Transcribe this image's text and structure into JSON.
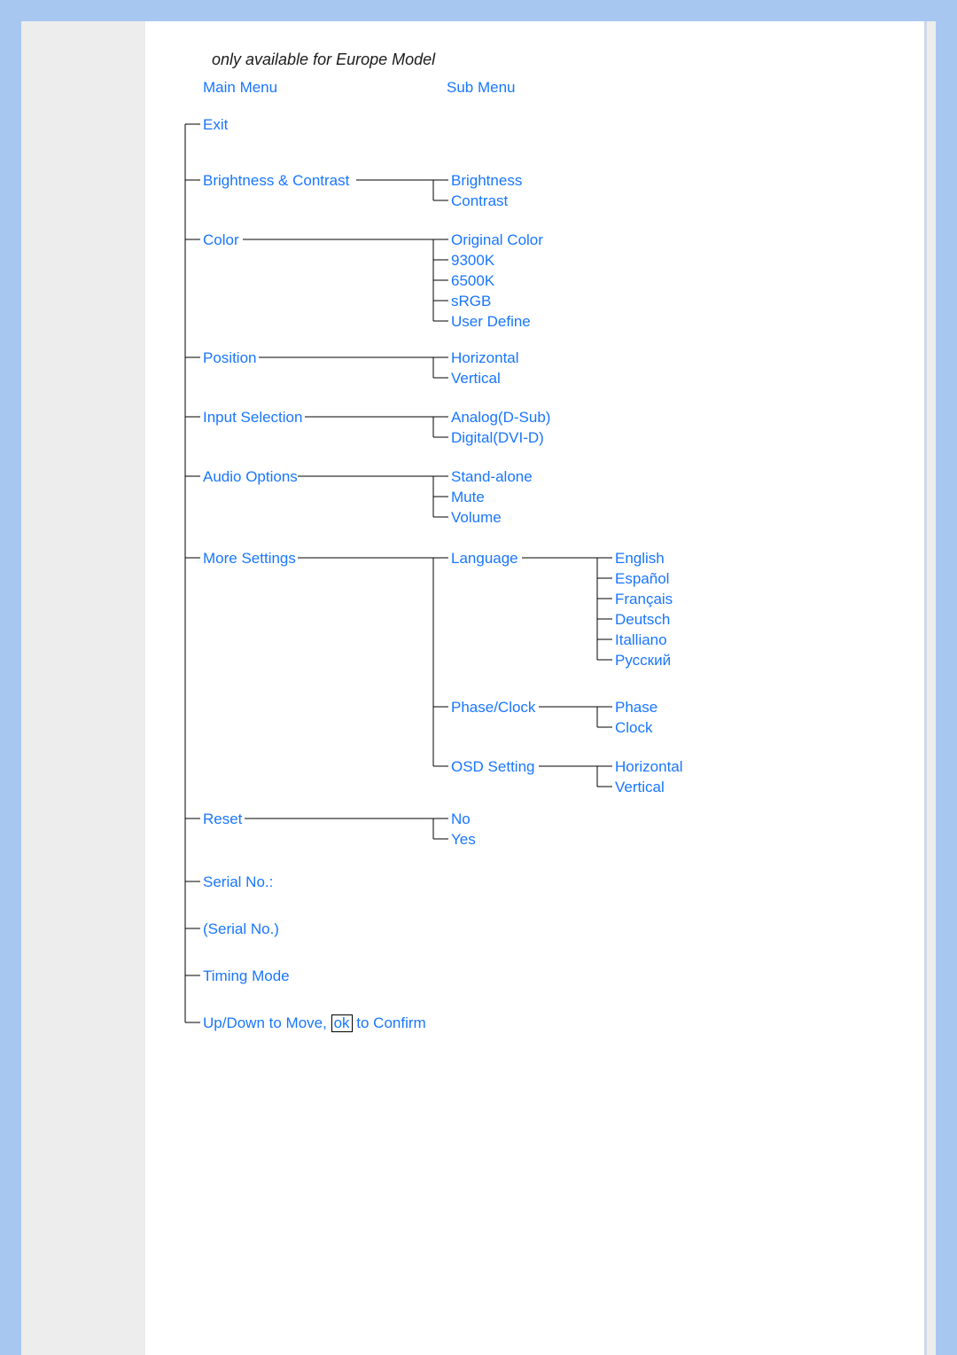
{
  "note": "only available for Europe Model",
  "headers": {
    "main": "Main Menu",
    "sub": "Sub Menu"
  },
  "main": {
    "exit": "Exit",
    "brightness_contrast": "Brightness & Contrast",
    "color": "Color",
    "position": "Position",
    "input_selection": "Input Selection",
    "audio_options": "Audio Options",
    "more_settings": "More Settings",
    "reset": "Reset",
    "serial_no_label": "Serial No.:",
    "serial_no_value": "(Serial No.)",
    "timing_mode": "Timing Mode",
    "hint_prefix": "Up/Down to Move,",
    "hint_ok": "ok",
    "hint_suffix": "to Confirm"
  },
  "sub": {
    "brightness": "Brightness",
    "contrast": "Contrast",
    "original_color": "Original Color",
    "c9300k": "9300K",
    "c6500k": "6500K",
    "srgb": "sRGB",
    "user_define": "User Define",
    "horizontal": "Horizontal",
    "vertical": "Vertical",
    "analog": "Analog(D-Sub)",
    "digital": "Digital(DVI-D)",
    "stand_alone": "Stand-alone",
    "mute": "Mute",
    "volume": "Volume",
    "language": "Language",
    "phase_clock": "Phase/Clock",
    "osd_setting": "OSD Setting",
    "no": "No",
    "yes": "Yes"
  },
  "third": {
    "english": "English",
    "espanol": "Español",
    "francais": "Français",
    "deutsch": "Deutsch",
    "italliano": "Italliano",
    "russian": "Русский",
    "phase": "Phase",
    "clock": "Clock",
    "osd_h": "Horizontal",
    "osd_v": "Vertical"
  }
}
